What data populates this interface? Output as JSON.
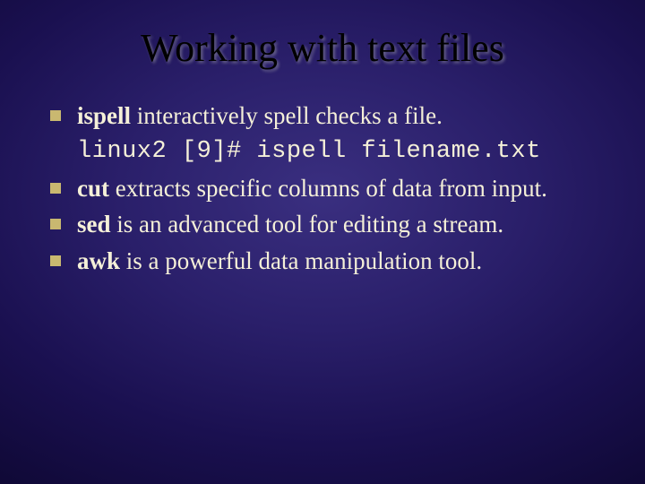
{
  "title": "Working with text files",
  "items": [
    {
      "bold": "ispell",
      "rest": " interactively spell checks a file.",
      "code": "linux2 [9]# ispell filename.txt"
    },
    {
      "bold": "cut",
      "rest": " extracts specific columns of data from input."
    },
    {
      "bold": "sed",
      "rest": " is an advanced tool for editing a stream."
    },
    {
      "bold": "awk",
      "rest": " is a powerful data manipulation tool."
    }
  ]
}
